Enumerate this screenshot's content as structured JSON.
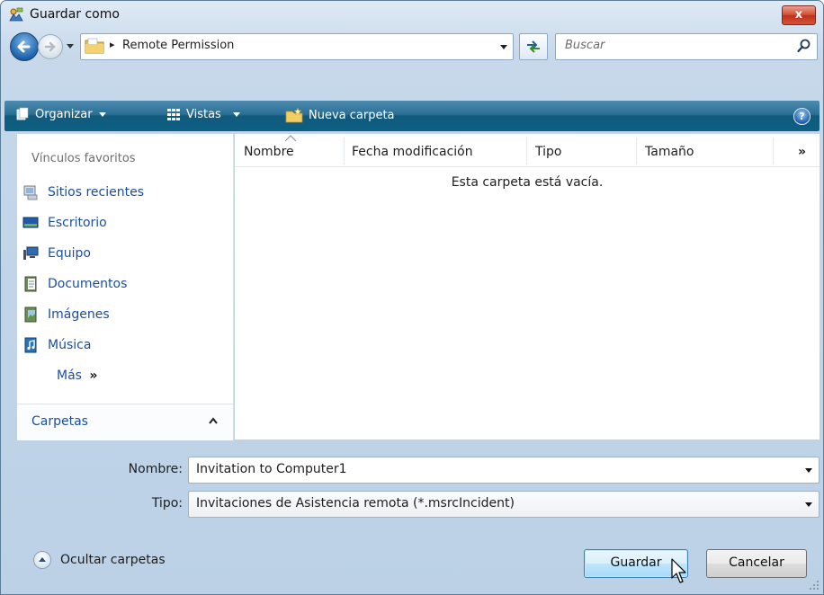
{
  "window": {
    "title": "Guardar como",
    "close_label": "x"
  },
  "navigation": {
    "breadcrumb_separator": "▸",
    "address": "Remote Permission",
    "search_placeholder": "Buscar"
  },
  "toolbar": {
    "organize": "Organizar",
    "views": "Vistas",
    "new_folder": "Nueva carpeta",
    "help": "?"
  },
  "sidebar": {
    "header": "Vínculos favoritos",
    "items": [
      {
        "label": "Sitios recientes",
        "icon": "recent-places-icon"
      },
      {
        "label": "Escritorio",
        "icon": "desktop-icon"
      },
      {
        "label": "Equipo",
        "icon": "computer-icon"
      },
      {
        "label": "Documentos",
        "icon": "documents-icon"
      },
      {
        "label": "Imágenes",
        "icon": "pictures-icon"
      },
      {
        "label": "Música",
        "icon": "music-icon"
      }
    ],
    "more": "Más",
    "more_glyph": "»",
    "folders_label": "Carpetas"
  },
  "file_list": {
    "columns": [
      "Nombre",
      "Fecha modificación",
      "Tipo",
      "Tamaño"
    ],
    "overflow": "»",
    "empty_message": "Esta carpeta está vacía."
  },
  "form": {
    "name_label": "Nombre:",
    "name_value": "Invitation to Computer1",
    "type_label": "Tipo:",
    "type_value": "Invitaciones de Asistencia remota (*.msrcIncident)"
  },
  "footer": {
    "hide_folders": "Ocultar carpetas",
    "save": "Guardar",
    "cancel": "Cancelar"
  },
  "colors": {
    "link": "#1a4e9e",
    "command_bar": "#1a6488",
    "close_button": "#c94a30",
    "save_button": "#bee6fd"
  }
}
